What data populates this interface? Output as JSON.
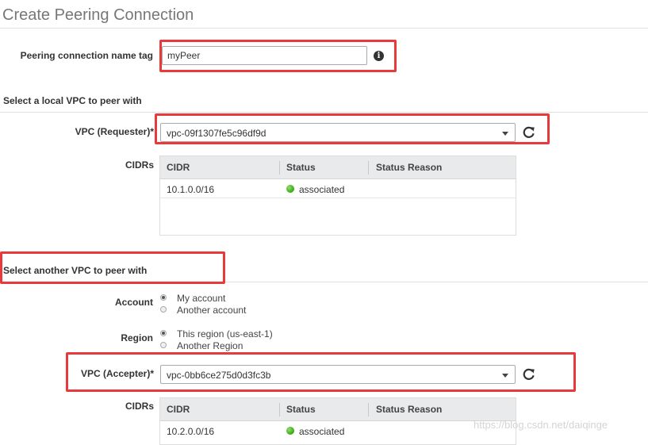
{
  "page": {
    "title": "Create Peering Connection",
    "watermark": "https://blog.csdn.net/daiqinge"
  },
  "name_tag": {
    "label": "Peering connection name tag",
    "value": "myPeer",
    "info_icon": "info-icon"
  },
  "local_section": {
    "title": "Select a local VPC to peer with",
    "vpc_label": "VPC (Requester)*",
    "vpc_value": "vpc-09f1307fe5c96df9d",
    "cidrs_label": "CIDRs",
    "table": {
      "headers": [
        "CIDR",
        "Status",
        "Status Reason"
      ],
      "rows": [
        {
          "cidr": "10.1.0.0/16",
          "status": "associated",
          "reason": ""
        }
      ]
    }
  },
  "another_section": {
    "title": "Select another VPC to peer with",
    "account_label": "Account",
    "account_options": [
      "My account",
      "Another account"
    ],
    "account_selected": "My account",
    "region_label": "Region",
    "region_options": [
      "This region (us-east-1)",
      "Another Region"
    ],
    "region_selected": "This region (us-east-1)",
    "vpc_label": "VPC (Accepter)*",
    "vpc_value": "vpc-0bb6ce275d0d3fc3b",
    "cidrs_label": "CIDRs",
    "table": {
      "headers": [
        "CIDR",
        "Status",
        "Status Reason"
      ],
      "rows": [
        {
          "cidr": "10.2.0.0/16",
          "status": "associated",
          "reason": ""
        }
      ]
    }
  },
  "colors": {
    "highlight": "#e83a3a",
    "status_ok": "#33a711",
    "table_header_bg": "#e9eaeb"
  }
}
